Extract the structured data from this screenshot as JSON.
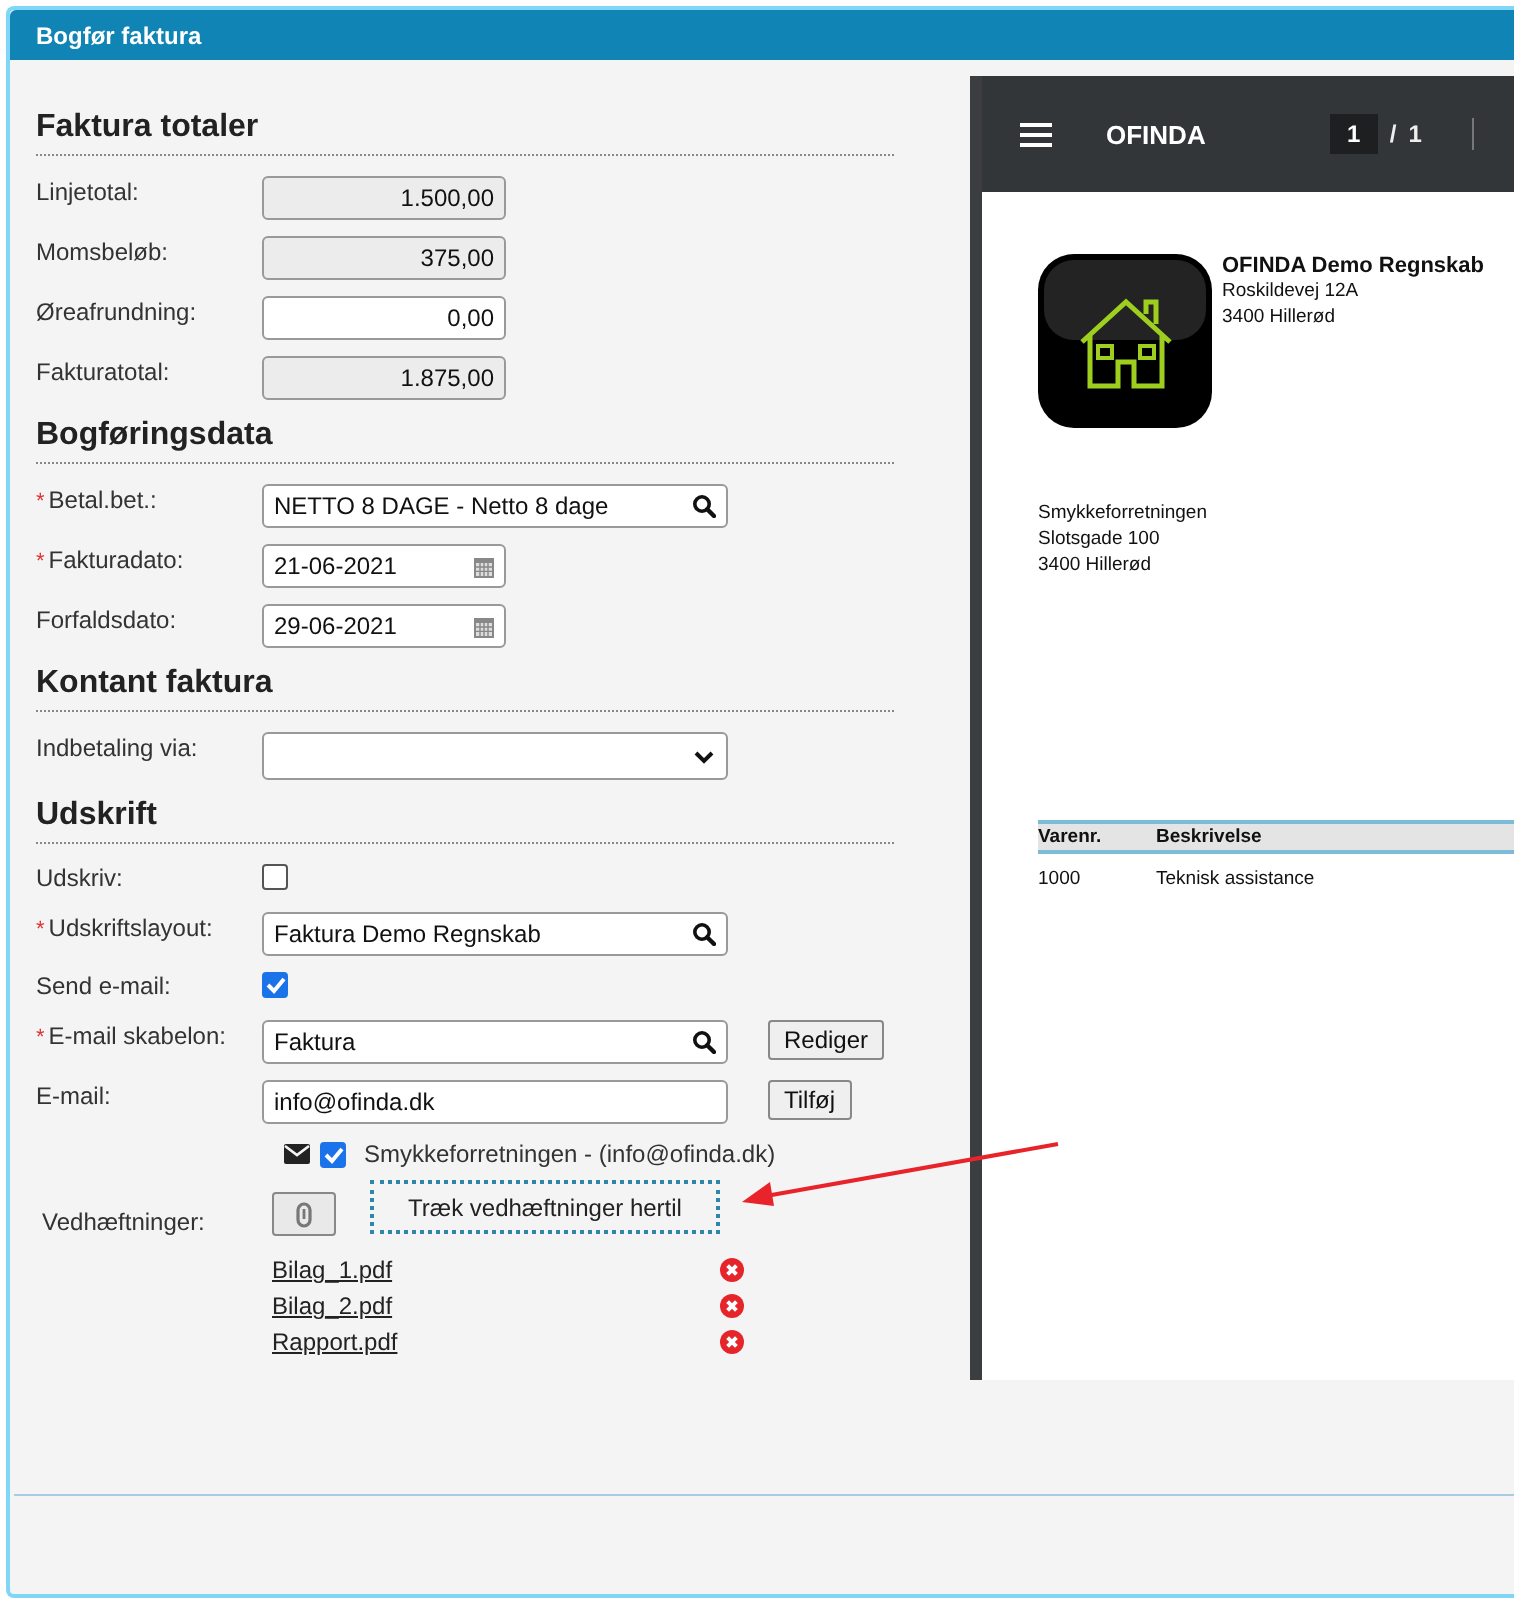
{
  "window": {
    "title": "Bogfør faktura"
  },
  "sections": [
    {
      "title": "Faktura totaler",
      "rows": [
        {
          "kind": "amount",
          "label": "Linjetotal:",
          "value": "1.500,00",
          "readonly": true
        },
        {
          "kind": "amount",
          "label": "Momsbeløb:",
          "value": "375,00",
          "readonly": true
        },
        {
          "kind": "amount",
          "label": "Øreafrundning:",
          "value": "0,00",
          "readonly": false
        },
        {
          "kind": "amount",
          "label": "Fakturatotal:",
          "value": "1.875,00",
          "readonly": true
        }
      ]
    },
    {
      "title": "Bogføringsdata",
      "rows": [
        {
          "kind": "lookup",
          "label": "Betal.bet.:",
          "value": "NETTO 8 DAGE - Netto 8 dage",
          "required_mark": "*"
        },
        {
          "kind": "date",
          "label": "Fakturadato:",
          "value": "21-06-2021",
          "required_mark": "*"
        },
        {
          "kind": "date",
          "label": "Forfaldsdato:",
          "value": "29-06-2021"
        }
      ]
    },
    {
      "title": "Kontant faktura",
      "rows": [
        {
          "kind": "select",
          "label": "Indbetaling via:"
        }
      ]
    },
    {
      "title": "Udskrift",
      "rows": [
        {
          "kind": "checkbox",
          "label": "Udskriv:",
          "checked": false
        },
        {
          "kind": "lookup",
          "label": "Udskriftslayout:",
          "value": "Faktura Demo Regnskab",
          "required_mark": "*"
        },
        {
          "kind": "checkbox",
          "label": "Send e-mail:",
          "checked": true
        },
        {
          "kind": "lookup",
          "label": "E-mail skabelon:",
          "value": "Faktura",
          "required_mark": "*",
          "button": "Rediger"
        },
        {
          "kind": "text",
          "label": "E-mail:",
          "value": "info@ofinda.dk",
          "button": "Tilføj"
        }
      ]
    }
  ],
  "recipient": {
    "checked": true,
    "text": "Smykkeforretningen - (info@ofinda.dk)"
  },
  "attachments": {
    "label": "Vedhæftninger:",
    "drop_text": "Træk vedhæftninger hertil",
    "files": [
      "Bilag_1.pdf",
      "Bilag_2.pdf",
      "Rapport.pdf"
    ]
  },
  "viewer": {
    "title": "OFINDA",
    "page": "1",
    "separator": "/",
    "total": "1",
    "company": {
      "name": "OFINDA Demo Regnskab",
      "lines": [
        "Roskildevej 12A",
        "3400  Hillerød"
      ]
    },
    "customer": [
      "Smykkeforretningen",
      "Slotsgade 100",
      "3400  Hillerød"
    ],
    "table": {
      "columns": [
        "Varenr.",
        "Beskrivelse"
      ],
      "rows": [
        [
          "1000",
          "Teknisk assistance"
        ]
      ]
    }
  }
}
